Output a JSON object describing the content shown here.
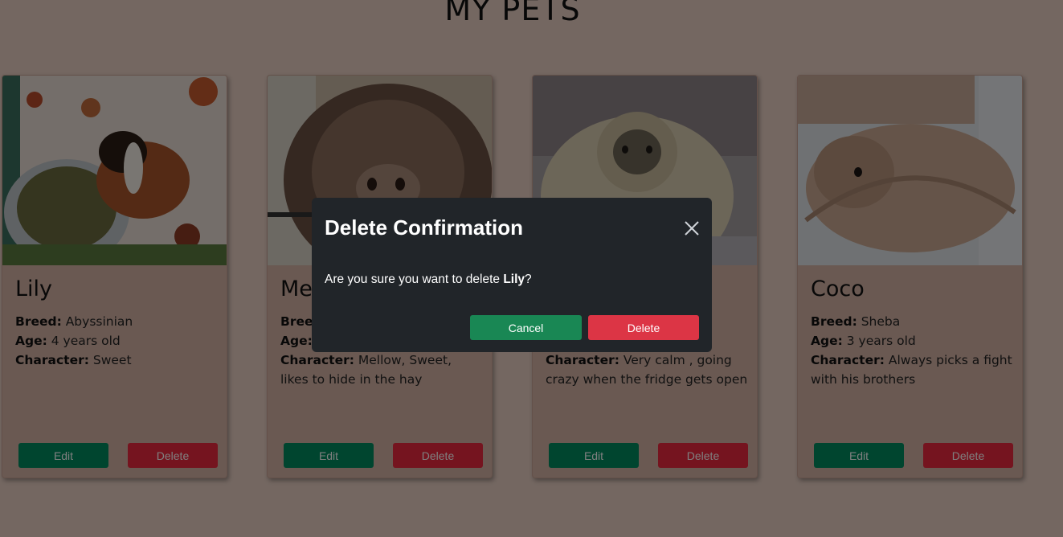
{
  "page": {
    "title": "MY PETS"
  },
  "pets": [
    {
      "name": "Lily",
      "breed_label": "Breed:",
      "breed": " Abyssinian",
      "age_label": "Age:",
      "age": " 4 years old",
      "character_label": "Character:",
      "character": " Sweet",
      "edit_label": "Edit",
      "delete_label": "Delete"
    },
    {
      "name": "Me",
      "breed_label": "Bree",
      "breed": "",
      "age_label": "Age:",
      "age": "",
      "character_label": "Character:",
      "character": " Mellow, Sweet, likes to hide in the hay",
      "edit_label": "Edit",
      "delete_label": "Delete"
    },
    {
      "name": "",
      "breed_label": "",
      "breed": "",
      "age_label": "",
      "age": "",
      "character_label": "Character:",
      "character": " Very calm , going crazy when the fridge gets open",
      "edit_label": "Edit",
      "delete_label": "Delete"
    },
    {
      "name": "Coco",
      "breed_label": "Breed:",
      "breed": " Sheba",
      "age_label": "Age:",
      "age": " 3 years old",
      "character_label": "Character:",
      "character": " Always picks a fight with his brothers",
      "edit_label": "Edit",
      "delete_label": "Delete"
    }
  ],
  "modal": {
    "title": "Delete Confirmation",
    "body_prefix": "Are you sure you want to delete ",
    "pet_name": "Lily",
    "body_suffix": "?",
    "cancel_label": "Cancel",
    "delete_label": "Delete",
    "close_icon": "close-icon"
  },
  "colors": {
    "background": "#e8cfc3",
    "card": "#d4b2a4",
    "edit_button": "#018a5f",
    "delete_button": "#eb283e",
    "modal": "#212529",
    "modal_cancel": "#198754",
    "modal_delete": "#dc3545"
  }
}
